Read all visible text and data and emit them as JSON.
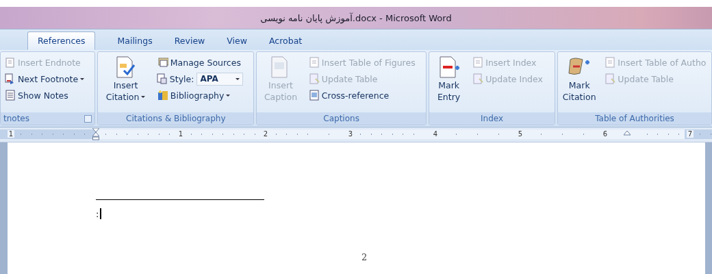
{
  "window": {
    "title": "آموزش پایان نامه نویسی.docx - Microsoft Word"
  },
  "tabs": [
    {
      "label": "References",
      "selected": true
    },
    {
      "label": "Mailings",
      "selected": false
    },
    {
      "label": "Review",
      "selected": false
    },
    {
      "label": "View",
      "selected": false
    },
    {
      "label": "Acrobat",
      "selected": false
    }
  ],
  "ribbon": {
    "groups": [
      {
        "label": "tnotes",
        "launcher": true,
        "items": [
          {
            "kind": "small",
            "label": "Insert Endnote",
            "disabled": true,
            "dropdown": false
          },
          {
            "kind": "small",
            "label": "Next Footnote",
            "disabled": false,
            "dropdown": true
          },
          {
            "kind": "small",
            "label": "Show Notes",
            "disabled": false,
            "dropdown": false
          }
        ]
      },
      {
        "label": "Citations & Bibliography",
        "items": [
          {
            "kind": "large",
            "lines": [
              "Insert",
              "Citation"
            ],
            "disabled": false,
            "dropdown": true
          },
          {
            "kind": "small",
            "label": "Manage Sources",
            "disabled": false,
            "dropdown": false
          },
          {
            "kind": "combo",
            "label": "Style:",
            "value": "APA",
            "disabled": false,
            "dropdown": true
          },
          {
            "kind": "small",
            "label": "Bibliography",
            "disabled": false,
            "dropdown": true
          }
        ]
      },
      {
        "label": "Captions",
        "items": [
          {
            "kind": "large",
            "lines": [
              "Insert",
              "Caption"
            ],
            "disabled": true,
            "dropdown": false
          },
          {
            "kind": "small",
            "label": "Insert Table of Figures",
            "disabled": true,
            "dropdown": false
          },
          {
            "kind": "small",
            "label": "Update Table",
            "disabled": true,
            "dropdown": false
          },
          {
            "kind": "small",
            "label": "Cross-reference",
            "disabled": false,
            "dropdown": false
          }
        ]
      },
      {
        "label": "Index",
        "items": [
          {
            "kind": "large",
            "lines": [
              "Mark",
              "Entry"
            ],
            "disabled": false,
            "dropdown": false
          },
          {
            "kind": "small",
            "label": "Insert Index",
            "disabled": true,
            "dropdown": false
          },
          {
            "kind": "small",
            "label": "Update Index",
            "disabled": true,
            "dropdown": false
          }
        ]
      },
      {
        "label": "Table of Authorities",
        "items": [
          {
            "kind": "large",
            "lines": [
              "Mark",
              "Citation"
            ],
            "disabled": false,
            "dropdown": false
          },
          {
            "kind": "small",
            "label": "Insert Table of Autho",
            "disabled": true,
            "dropdown": false
          },
          {
            "kind": "small",
            "label": "Update Table",
            "disabled": true,
            "dropdown": false
          }
        ]
      }
    ]
  },
  "ruler": {
    "labels": [
      "1",
      "1",
      "2",
      "3",
      "4",
      "5",
      "6",
      "7"
    ]
  },
  "document": {
    "footnote_text": ":",
    "page_number": "2"
  }
}
